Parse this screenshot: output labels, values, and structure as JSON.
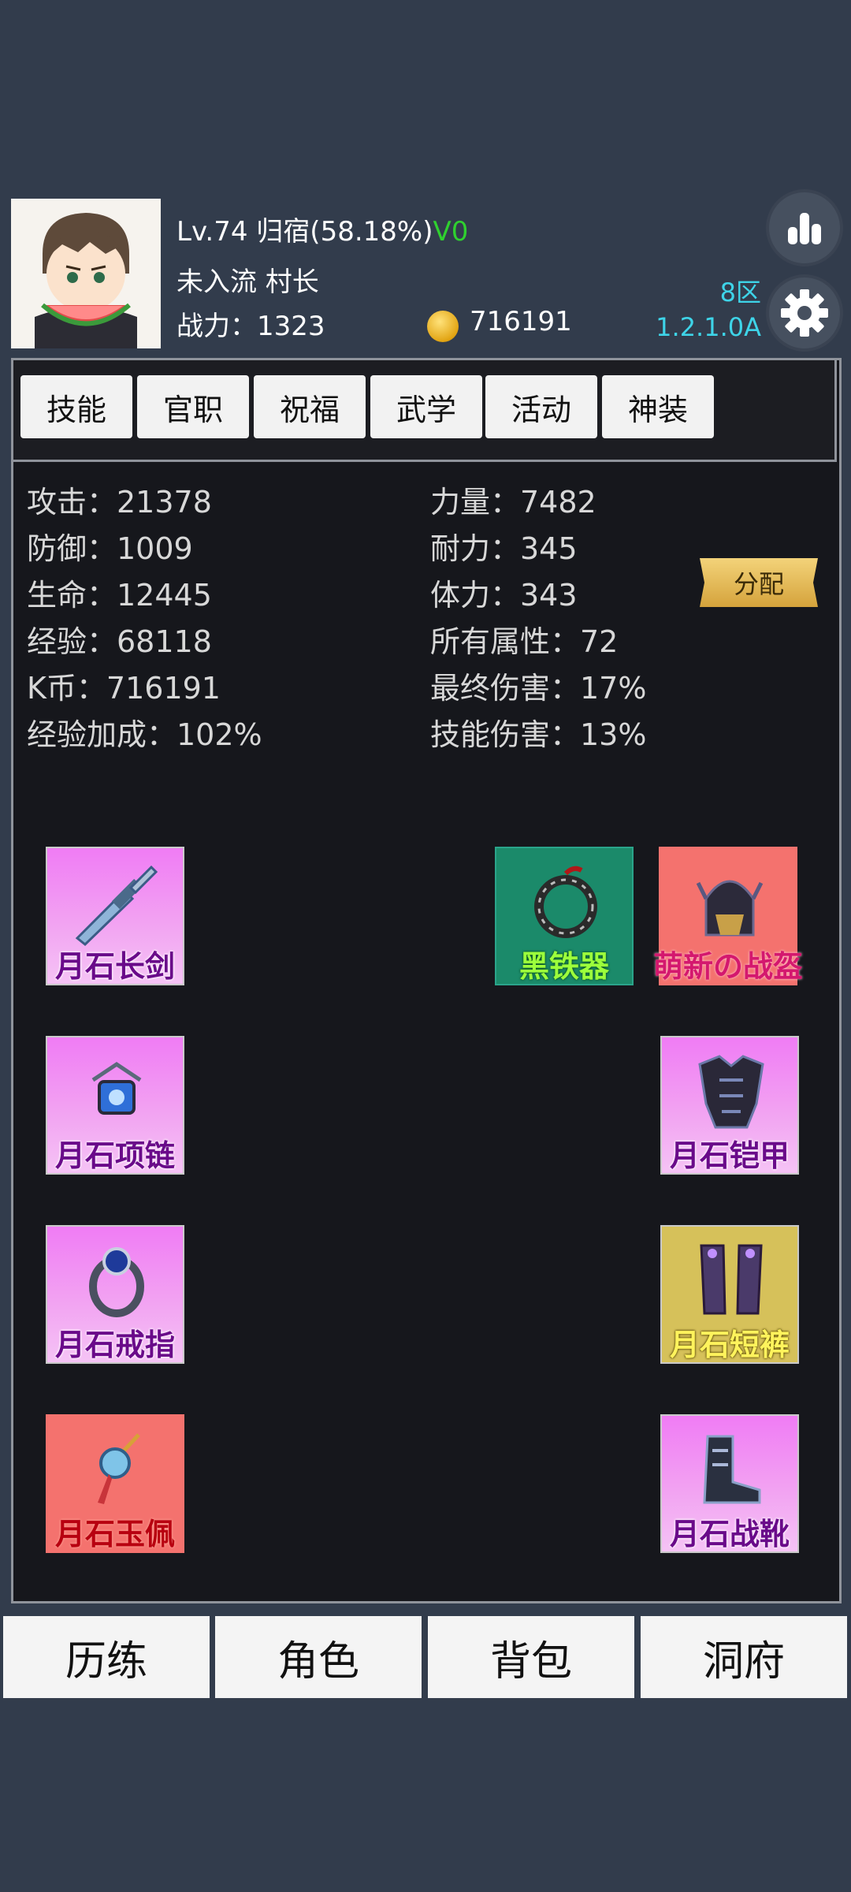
{
  "header": {
    "level_line": "Lv.74 归宿(58.18%)",
    "vip": "V0",
    "rank_line": "未入流 村长",
    "power_line": "战力：1323",
    "coins": "716191",
    "server": "8区",
    "version": "1.2.1.0A"
  },
  "tabs": [
    "技能",
    "官职",
    "祝福",
    "武学",
    "活动",
    "神装"
  ],
  "stats_left": [
    "攻击：21378",
    "防御：1009",
    "生命：12445",
    "经验：68118",
    "K币：716191",
    "经验加成：102%"
  ],
  "stats_right": [
    "力量：7482",
    "耐力：345",
    "体力：343",
    "所有属性：72",
    "最终伤害：17%",
    "技能伤害：13%"
  ],
  "allocate_label": "分配",
  "equipment": {
    "sword": "月石长剑",
    "necklace": "月石项链",
    "ring": "月石戒指",
    "pendant": "月石玉佩",
    "artifact": "黑铁器",
    "helmet": "萌新の战盔",
    "armor": "月石铠甲",
    "pants": "月石短裤",
    "boots": "月石战靴"
  },
  "nav": [
    "历练",
    "角色",
    "背包",
    "洞府"
  ],
  "colors": {
    "background": "#323c4c",
    "panel": "#16171c",
    "accent_cyan": "#3ed4e8",
    "vip_green": "#2fd02f"
  }
}
